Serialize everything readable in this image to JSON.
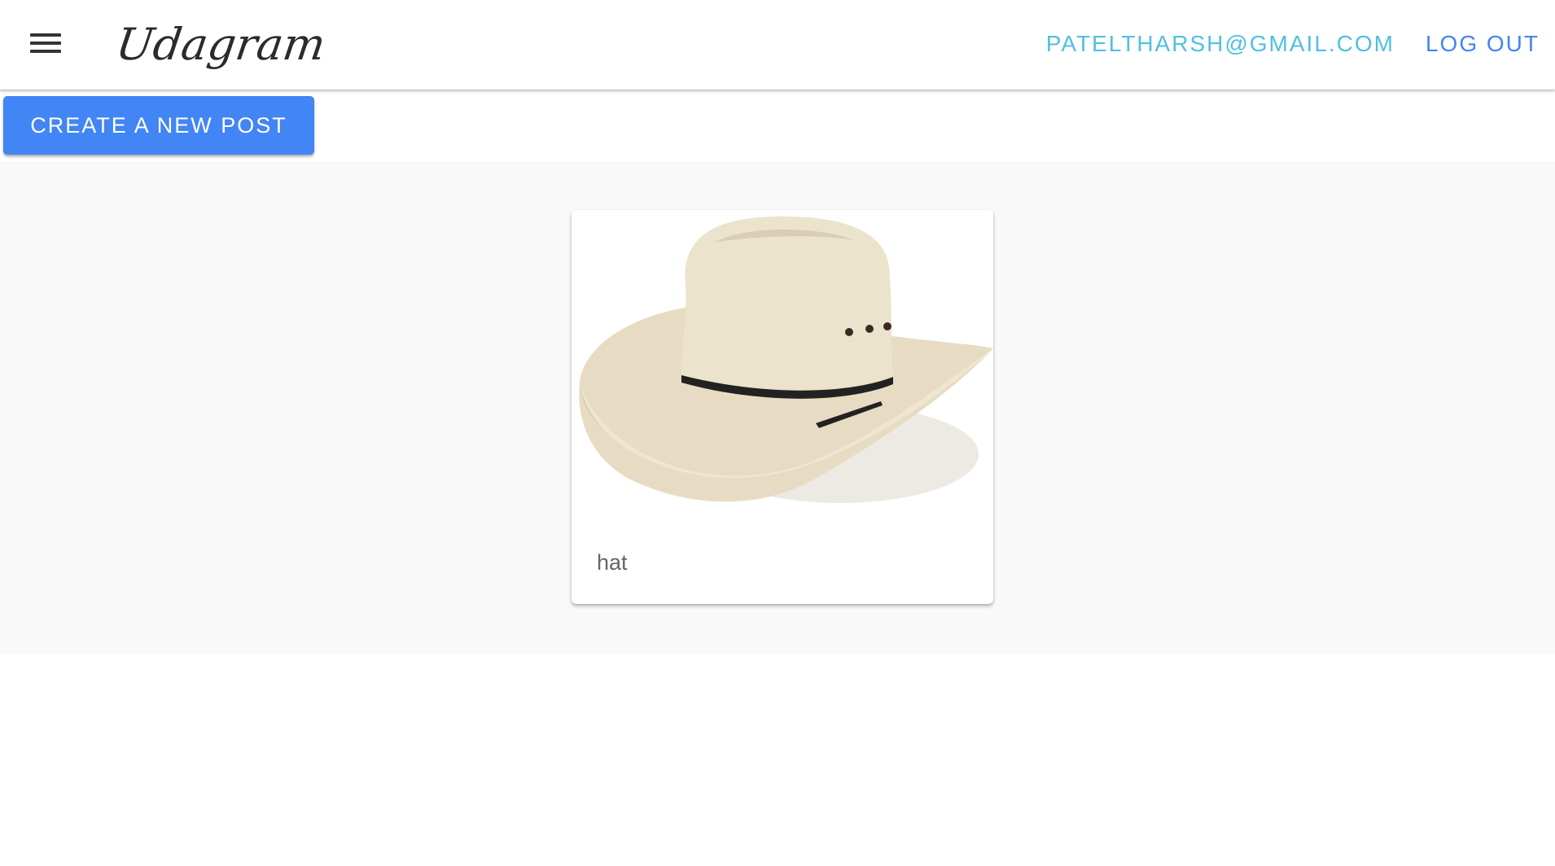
{
  "header": {
    "brand": "Udagram",
    "user_email": "PATELTHARSH@GMAIL.COM",
    "logout_label": "LOG OUT",
    "menu_icon": "hamburger-menu-icon"
  },
  "actions": {
    "create_post_label": "CREATE A NEW POST"
  },
  "feed": {
    "posts": [
      {
        "caption": "hat",
        "image_subject": "cowboy-hat"
      }
    ]
  },
  "colors": {
    "primary": "#4285f4",
    "email_link": "#4fc0e0",
    "logout_link": "#4285f4",
    "feed_background": "#f9f9f9"
  }
}
